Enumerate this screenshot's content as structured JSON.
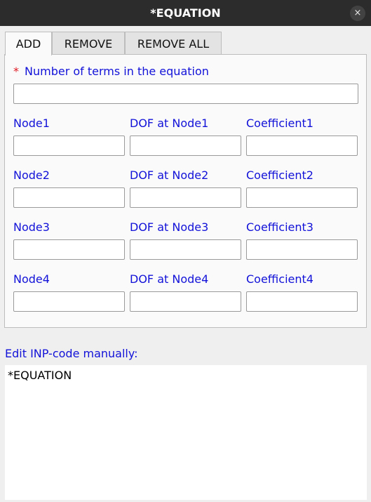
{
  "window": {
    "title": "*EQUATION",
    "close_icon": "×"
  },
  "tabs": [
    {
      "label": "ADD",
      "active": true
    },
    {
      "label": "REMOVE",
      "active": false
    },
    {
      "label": "REMOVE ALL",
      "active": false
    }
  ],
  "form": {
    "required_marker": "*",
    "num_terms_label": "Number of terms in the equation",
    "num_terms_value": "",
    "rows": [
      {
        "node_label": "Node1",
        "dof_label": "DOF at Node1",
        "coef_label": "Coefficient1",
        "node_value": "",
        "dof_value": "",
        "coef_value": ""
      },
      {
        "node_label": "Node2",
        "dof_label": "DOF at Node2",
        "coef_label": "Coefficient2",
        "node_value": "",
        "dof_value": "",
        "coef_value": ""
      },
      {
        "node_label": "Node3",
        "dof_label": "DOF at Node3",
        "coef_label": "Coefficient3",
        "node_value": "",
        "dof_value": "",
        "coef_value": ""
      },
      {
        "node_label": "Node4",
        "dof_label": "DOF at Node4",
        "coef_label": "Coefficient4",
        "node_value": "",
        "dof_value": "",
        "coef_value": ""
      }
    ]
  },
  "inp_editor": {
    "label": "Edit INP-code manually:",
    "content": "*EQUATION"
  },
  "colors": {
    "label_blue": "#1212d9",
    "required_red": "#e01b24",
    "titlebar": "#2c2c2c"
  }
}
